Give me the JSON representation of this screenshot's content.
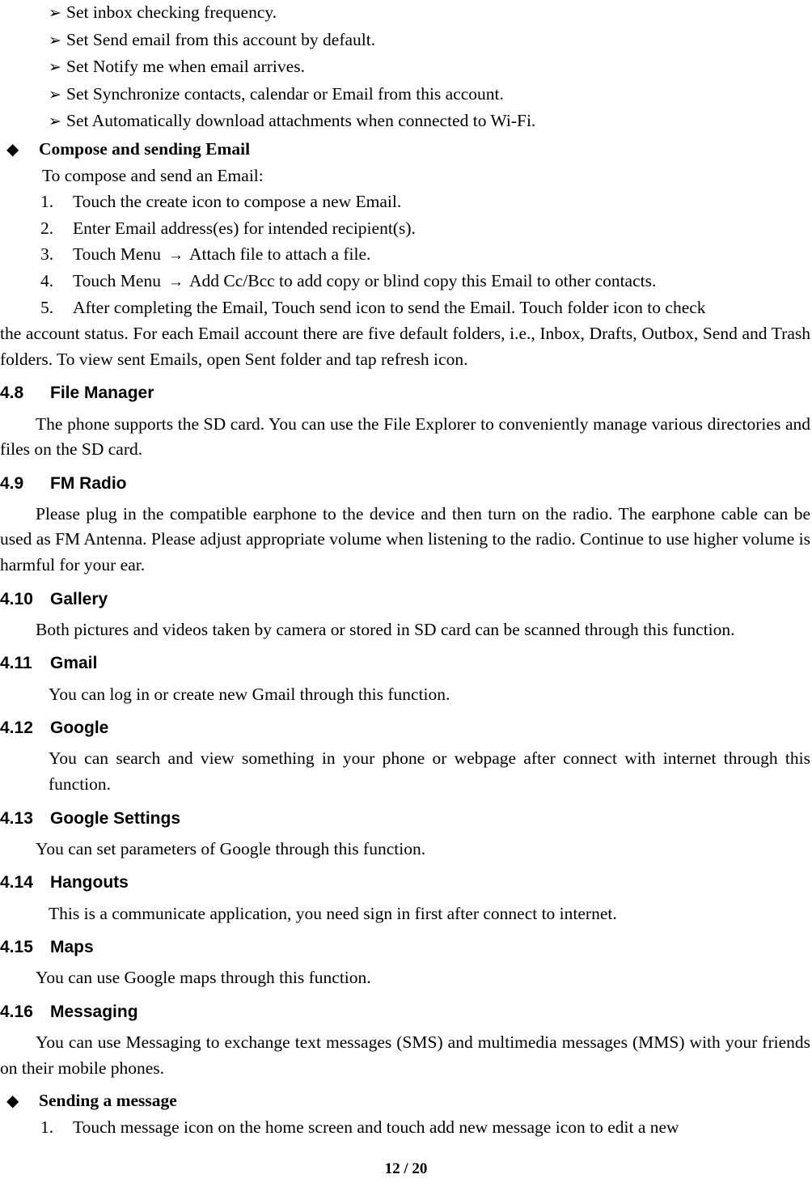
{
  "document": {
    "page_footer": "12 / 20"
  },
  "markers": {
    "arrowhead_bullet": "➢",
    "diamond_bullet": "◆",
    "right_arrow": "→"
  },
  "email_settings_bullets": [
    "Set inbox checking frequency.",
    "Set Send email from this account by default.",
    "Set Notify me when email arrives.",
    "Set Synchronize contacts, calendar or Email from this account.",
    "Set Automatically download attachments when connected to Wi-Fi."
  ],
  "compose_section": {
    "heading": "Compose and sending Email",
    "intro": "To compose and send an Email:",
    "steps": [
      {
        "num": "1.",
        "text": "Touch the create icon to compose a new Email."
      },
      {
        "num": "2.",
        "text": "Enter Email address(es) for intended recipient(s)."
      },
      {
        "num": "3.",
        "pre": "Touch Menu",
        "post": "Attach file to attach a file."
      },
      {
        "num": "4.",
        "pre": "Touch Menu",
        "post": "Add Cc/Bcc to add copy or blind copy this Email to other contacts."
      },
      {
        "num": "5.",
        "text": "After completing the Email, Touch send icon to send the Email. Touch folder icon to check"
      }
    ],
    "step5_continuation": "the account status. For each Email account there are five default folders, i.e., Inbox, Drafts, Outbox, Send and Trash folders. To view sent Emails, open Sent folder and tap refresh icon."
  },
  "sections": [
    {
      "number": "4.8",
      "title": "File Manager",
      "body": "The phone supports the SD card. You can use the File Explorer to conveniently manage various directories and files on the SD card."
    },
    {
      "number": "4.9",
      "title": "FM Radio",
      "body": "Please plug in the compatible earphone to the device and then turn on the radio. The earphone cable can be used as FM Antenna. Please adjust appropriate volume when listening to the radio. Continue to use higher volume is harmful for your ear."
    },
    {
      "number": "4.10",
      "title": "Gallery",
      "body": "Both pictures and videos taken by camera or stored in SD card can be scanned through this function."
    },
    {
      "number": "4.11",
      "title": "Gmail",
      "body": "You can log in or create new Gmail through this function."
    },
    {
      "number": "4.12",
      "title": "Google",
      "body": "You can search and view something in your phone or webpage after connect with internet through this function."
    },
    {
      "number": "4.13",
      "title": "Google Settings",
      "body": "You can set parameters of Google through this function."
    },
    {
      "number": "4.14",
      "title": "Hangouts",
      "body": "This is a communicate application, you need sign in first after connect to internet."
    },
    {
      "number": "4.15",
      "title": "Maps",
      "body": "You can use Google maps through this function."
    },
    {
      "number": "4.16",
      "title": "Messaging",
      "body": "You can use Messaging to exchange text messages (SMS) and multimedia messages (MMS) with your friends on their mobile phones."
    }
  ],
  "sending_message": {
    "heading": "Sending a message",
    "steps": [
      {
        "num": "1.",
        "text": "Touch message icon on the home screen and touch add new message icon to edit a new"
      }
    ]
  }
}
